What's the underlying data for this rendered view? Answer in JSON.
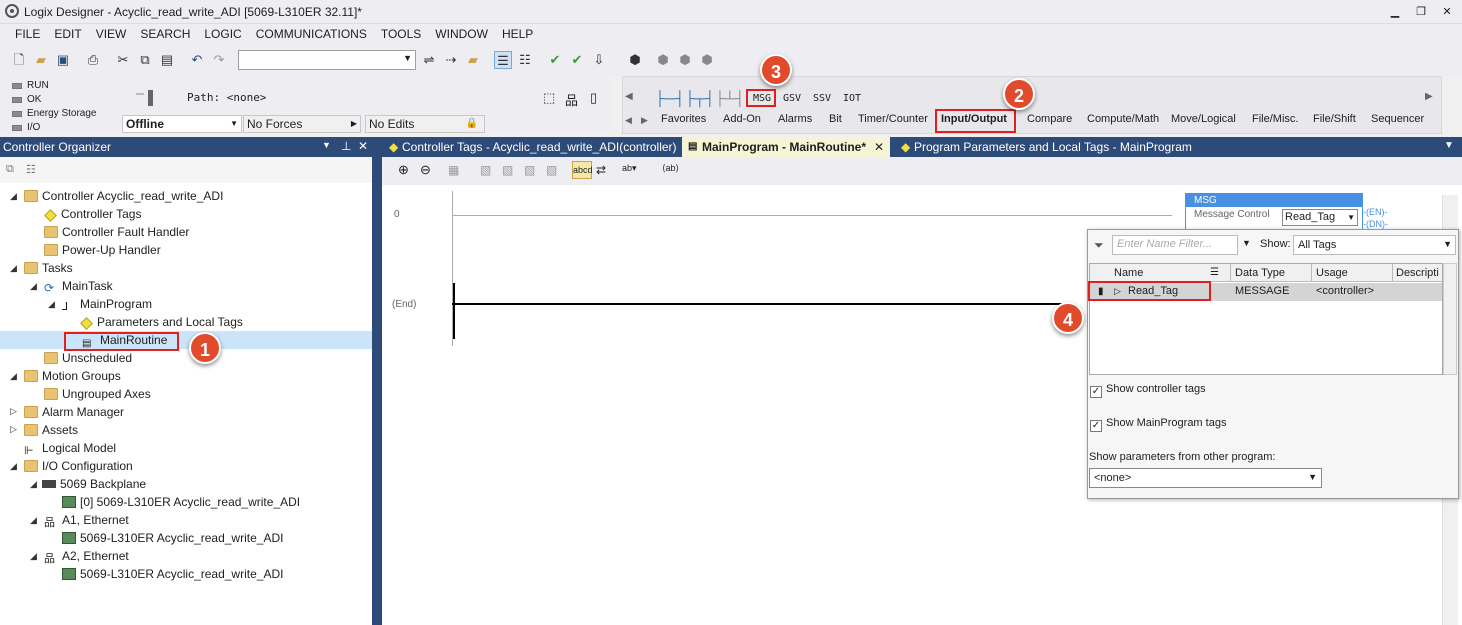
{
  "window": {
    "title": "Logix Designer - Acyclic_read_write_ADI [5069-L310ER 32.11]*"
  },
  "menu": [
    "FILE",
    "EDIT",
    "VIEW",
    "SEARCH",
    "LOGIC",
    "COMMUNICATIONS",
    "TOOLS",
    "WINDOW",
    "HELP"
  ],
  "status": {
    "run": "RUN",
    "ok": "OK",
    "energy": "Energy Storage",
    "io": "I/O",
    "path": "Path: <none>",
    "mode": "Offline",
    "forces": "No Forces",
    "edits": "No Edits"
  },
  "instructions": {
    "msg": "MSG",
    "gsv": "GSV",
    "ssv": "SSV",
    "iot": "IOT",
    "tabs": [
      "Favorites",
      "Add-On",
      "Alarms",
      "Bit",
      "Timer/Counter",
      "Input/Output",
      "Compare",
      "Compute/Math",
      "Move/Logical",
      "File/Misc.",
      "File/Shift",
      "Sequencer"
    ]
  },
  "organizer": {
    "title": "Controller Organizer",
    "tree": [
      "Controller Acyclic_read_write_ADI",
      "Controller Tags",
      "Controller Fault Handler",
      "Power-Up Handler",
      "Tasks",
      "MainTask",
      "MainProgram",
      "Parameters and Local Tags",
      "MainRoutine",
      "Unscheduled",
      "Motion Groups",
      "Ungrouped Axes",
      "Alarm Manager",
      "Assets",
      "Logical Model",
      "I/O Configuration",
      "5069 Backplane",
      "[0] 5069-L310ER Acyclic_read_write_ADI",
      "A1, Ethernet",
      "5069-L310ER Acyclic_read_write_ADI",
      "A2, Ethernet",
      "5069-L310ER Acyclic_read_write_ADI"
    ]
  },
  "tabs": [
    "Controller Tags - Acyclic_read_write_ADI(controller)",
    "MainProgram - MainRoutine*",
    "Program Parameters and Local Tags - MainProgram"
  ],
  "ladder": {
    "rung0": "0",
    "end": "(End)",
    "msg_title": "MSG",
    "msg_label": "Message Control",
    "msg_tag": "Read_Tag",
    "en": "EN",
    "dn": "DN"
  },
  "tag_browser": {
    "filter_placeholder": "Enter Name Filter...",
    "show_label": "Show:",
    "show_value": "All Tags",
    "columns": [
      "Name",
      "Data Type",
      "Usage",
      "Descripti"
    ],
    "row": {
      "name": "Read_Tag",
      "type": "MESSAGE",
      "usage": "<controller>"
    },
    "show_controller": "Show controller tags",
    "show_program": "Show MainProgram tags",
    "other_label": "Show parameters from other program:",
    "other_value": "<none>"
  },
  "badges": [
    "1",
    "2",
    "3",
    "4"
  ],
  "colors": {
    "accent": "#2d4b78",
    "badge": "#e24a2c",
    "highlight": "#e02020"
  }
}
